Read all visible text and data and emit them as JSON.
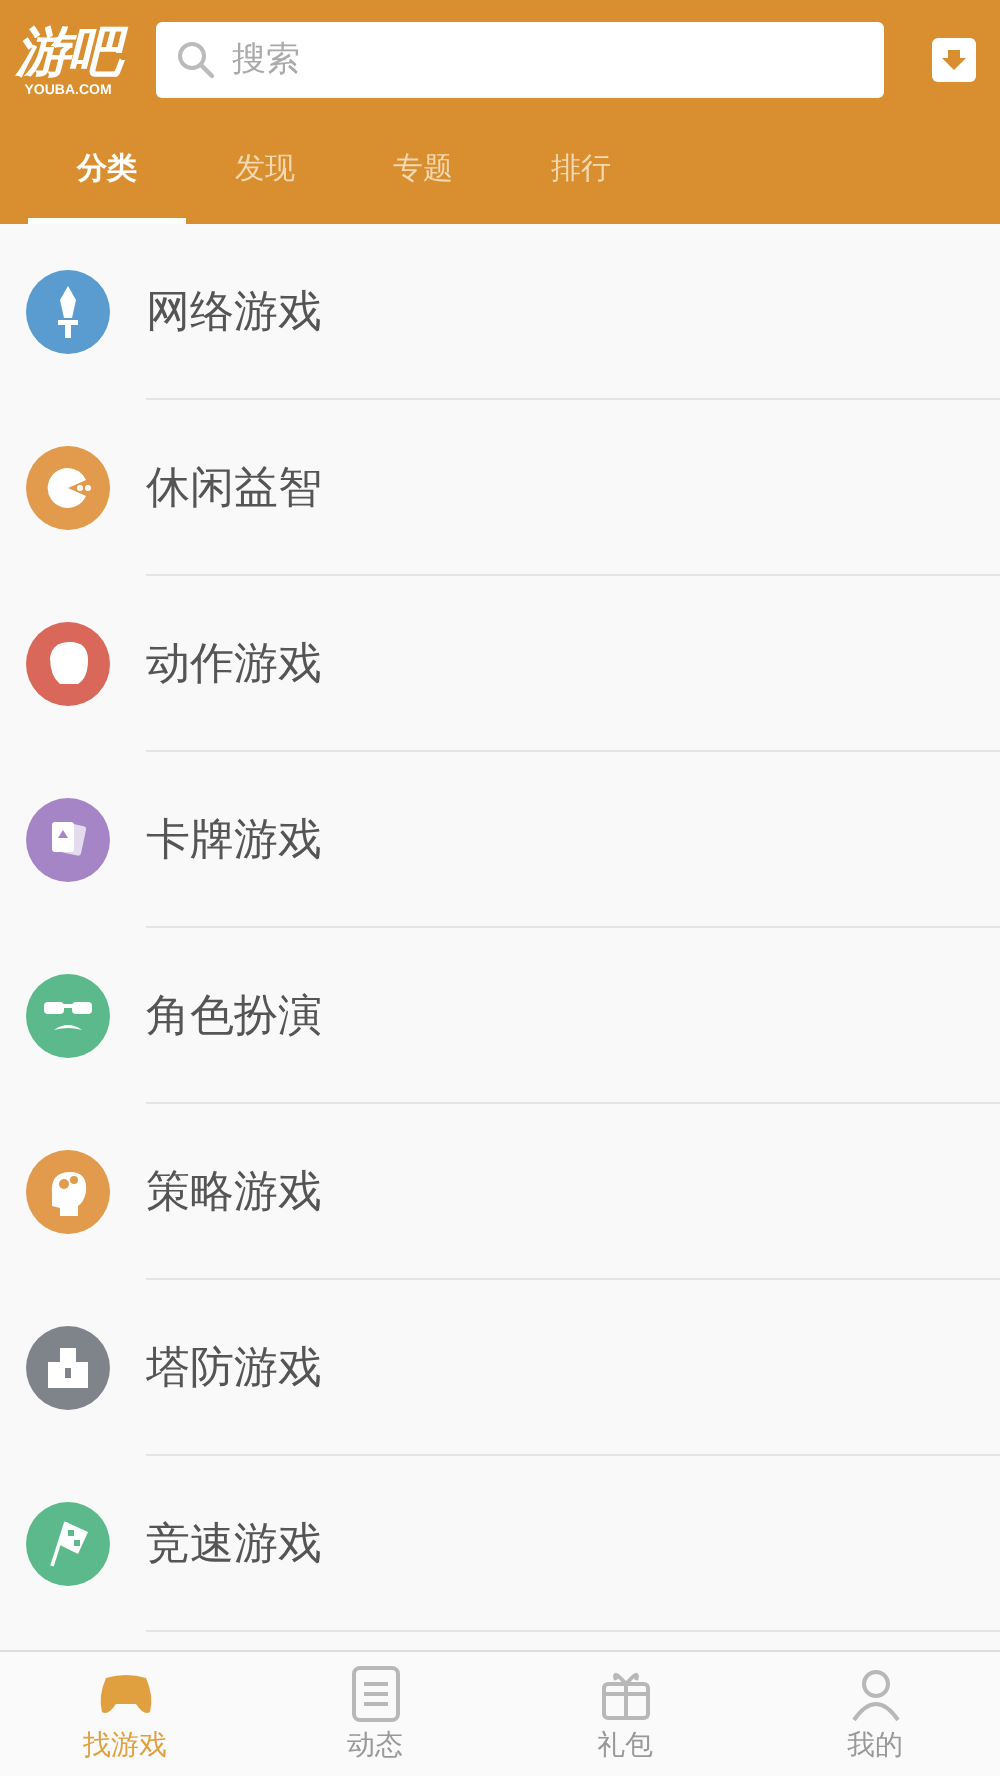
{
  "header": {
    "logo": {
      "name": "游吧",
      "domain": "YOUBA.COM"
    },
    "search": {
      "placeholder": "搜索"
    }
  },
  "tabs": [
    {
      "label": "分类",
      "selected": true
    },
    {
      "label": "发现",
      "selected": false
    },
    {
      "label": "专题",
      "selected": false
    },
    {
      "label": "排行",
      "selected": false
    }
  ],
  "categories": [
    {
      "label": "网络游戏",
      "color": "#5a9bd0"
    },
    {
      "label": "休闲益智",
      "color": "#e29a4c"
    },
    {
      "label": "动作游戏",
      "color": "#d9675a"
    },
    {
      "label": "卡牌游戏",
      "color": "#a685c6"
    },
    {
      "label": "角色扮演",
      "color": "#5bb98b"
    },
    {
      "label": "策略游戏",
      "color": "#e29a4c"
    },
    {
      "label": "塔防游戏",
      "color": "#7f848b"
    },
    {
      "label": "竞速游戏",
      "color": "#5bb98b"
    }
  ],
  "bottom_nav": [
    {
      "label": "找游戏",
      "selected": true
    },
    {
      "label": "动态",
      "selected": false
    },
    {
      "label": "礼包",
      "selected": false
    },
    {
      "label": "我的",
      "selected": false
    }
  ]
}
